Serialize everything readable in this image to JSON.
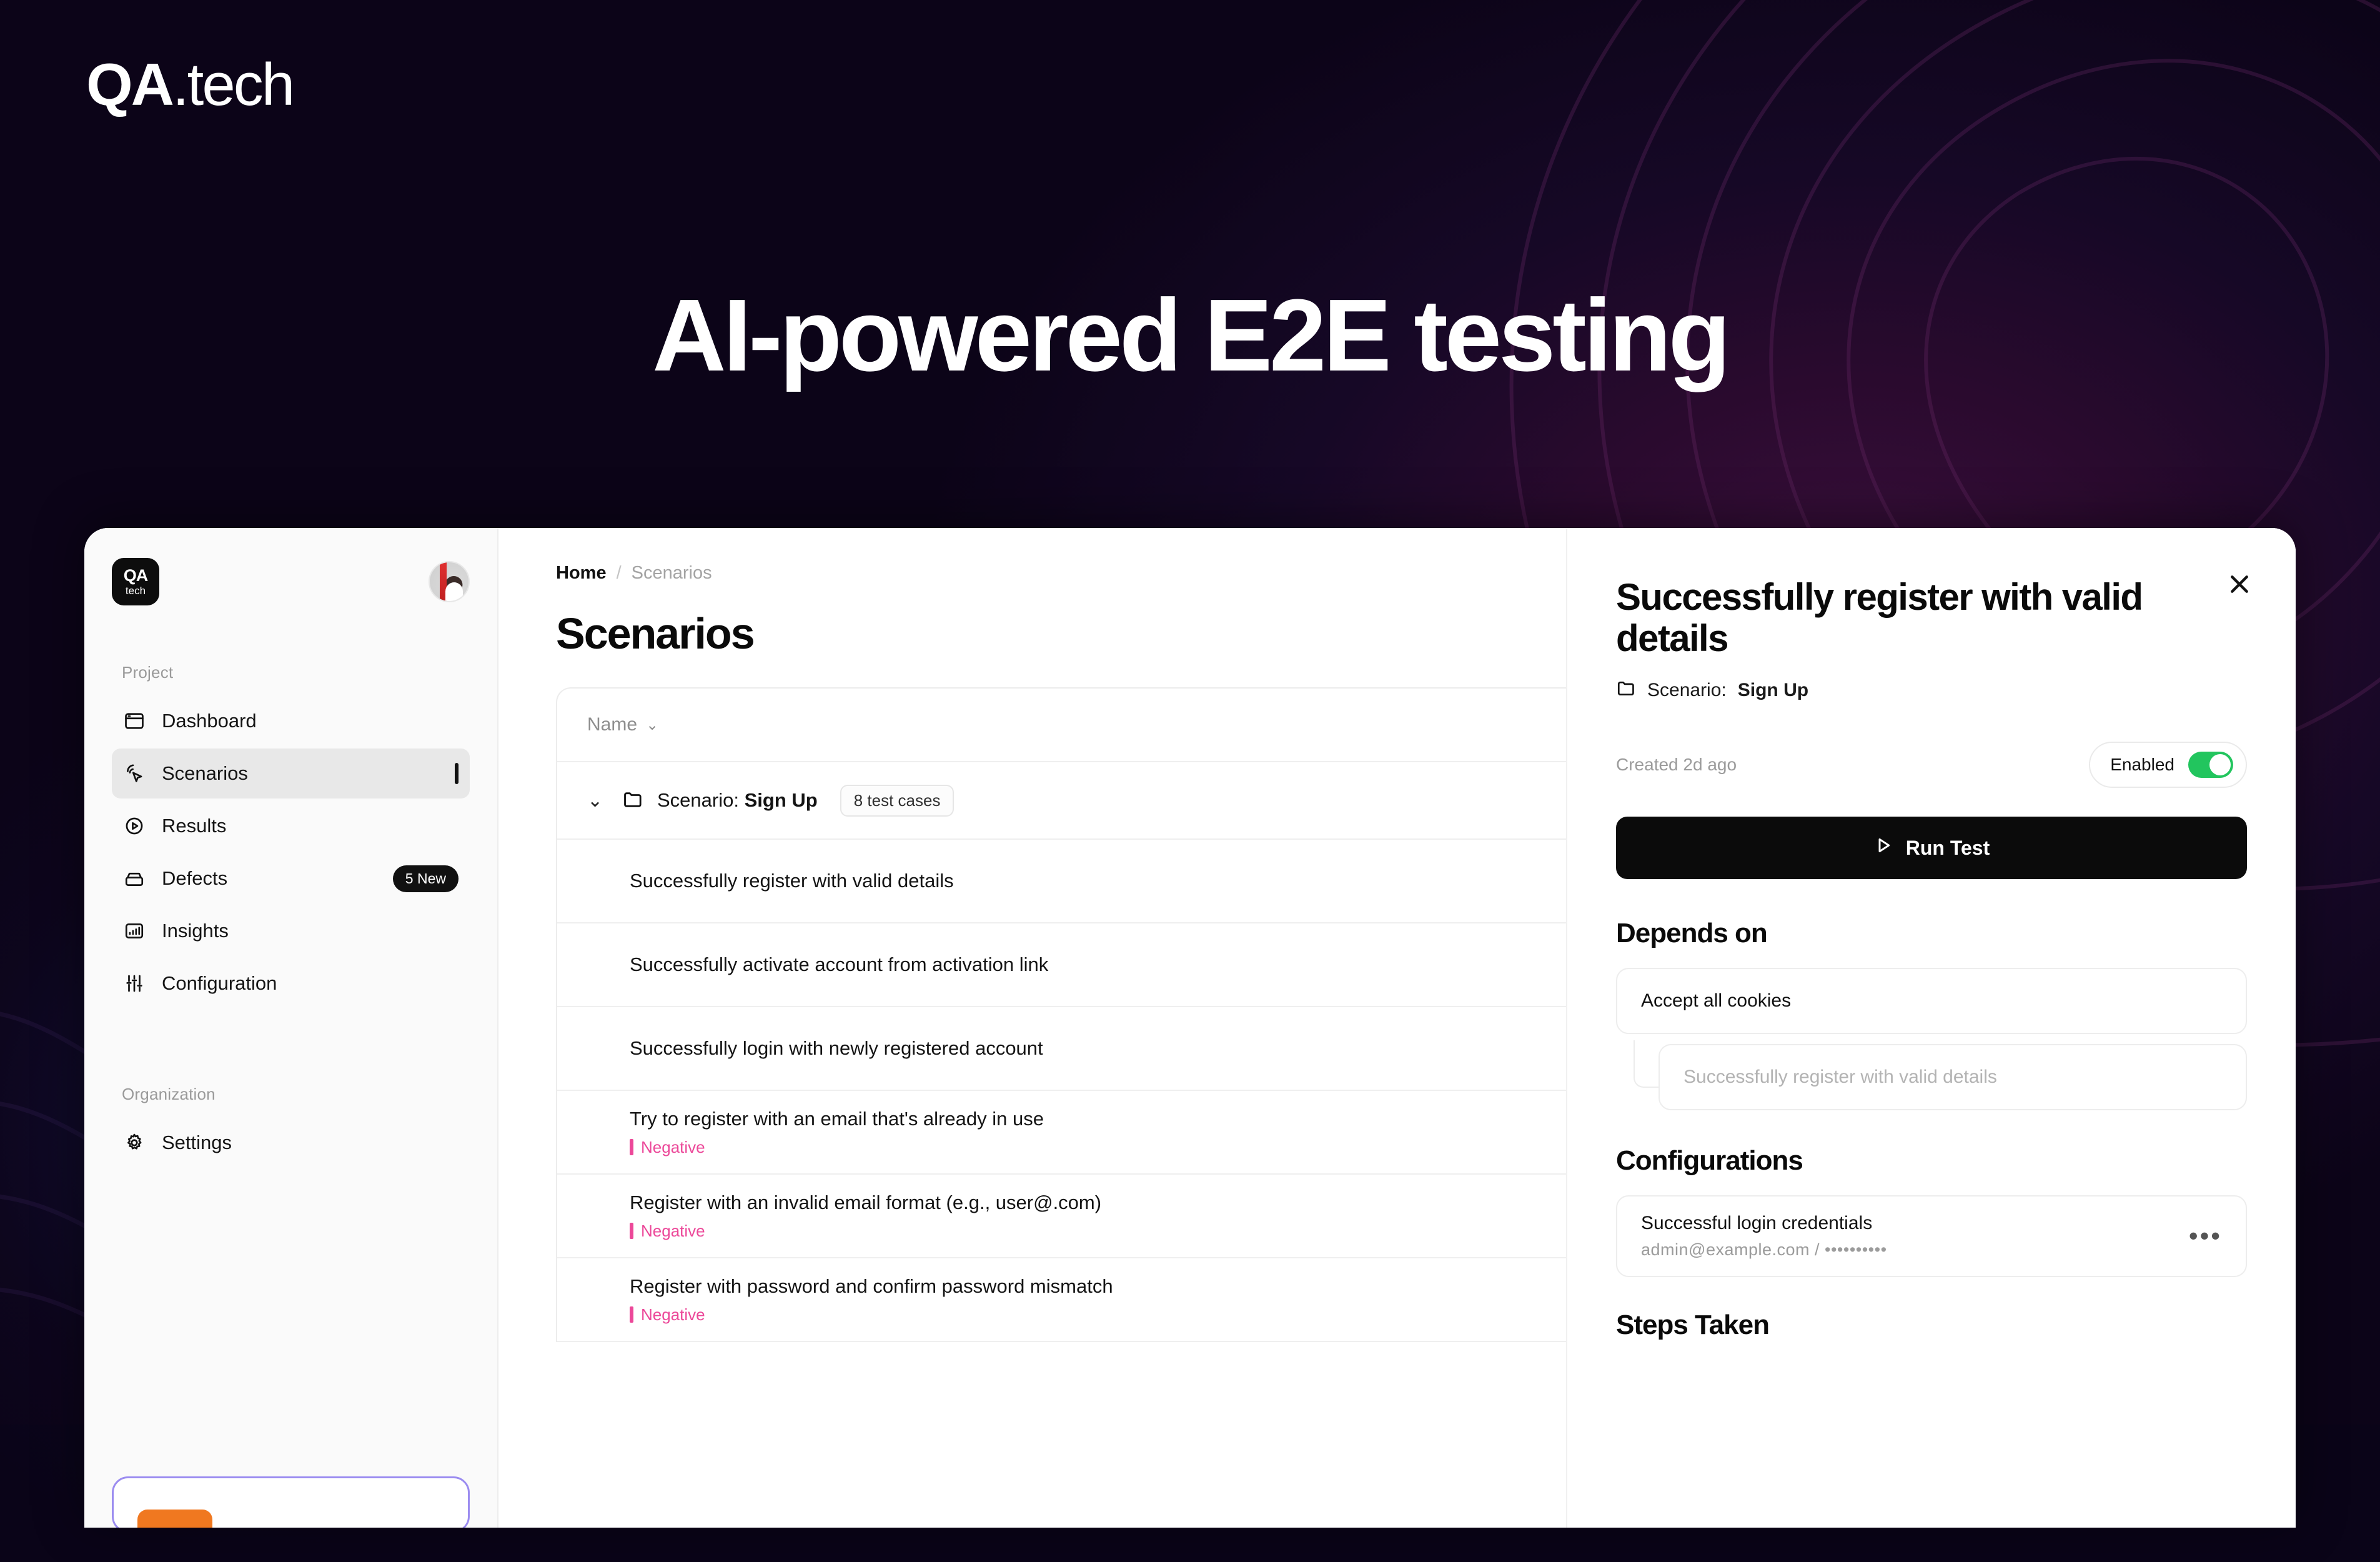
{
  "hero": {
    "logo_main": "QA",
    "logo_suffix": ".tech",
    "headline": "AI-powered E2E testing"
  },
  "sidebar": {
    "logo_tile_top": "QA",
    "logo_tile_bottom": "tech",
    "sections": [
      {
        "label": "Project",
        "items": [
          {
            "label": "Dashboard",
            "icon": "browser-window-icon",
            "active": false,
            "badge": ""
          },
          {
            "label": "Scenarios",
            "icon": "cursor-click-icon",
            "active": true,
            "badge": ""
          },
          {
            "label": "Results",
            "icon": "play-circle-icon",
            "active": false,
            "badge": ""
          },
          {
            "label": "Defects",
            "icon": "bug-box-icon",
            "active": false,
            "badge": "5 New"
          },
          {
            "label": "Insights",
            "icon": "bar-chart-icon",
            "active": false,
            "badge": ""
          },
          {
            "label": "Configuration",
            "icon": "sliders-icon",
            "active": false,
            "badge": ""
          }
        ]
      },
      {
        "label": "Organization",
        "items": [
          {
            "label": "Settings",
            "icon": "gear-icon",
            "active": false,
            "badge": ""
          }
        ]
      }
    ]
  },
  "main": {
    "breadcrumb": {
      "home": "Home",
      "separator": "/",
      "current": "Scenarios"
    },
    "page_title": "Scenarios",
    "table": {
      "sort_column": "Name",
      "scenario_group": {
        "prefix": "Scenario:",
        "name": "Sign Up",
        "chip": "8 test cases"
      },
      "test_cases": [
        {
          "name": "Successfully register with valid details",
          "tag": ""
        },
        {
          "name": "Successfully activate account from activation link",
          "tag": ""
        },
        {
          "name": "Successfully login with newly registered account",
          "tag": ""
        },
        {
          "name": "Try to register with an email that's already in use",
          "tag": "Negative"
        },
        {
          "name": "Register with an invalid email format (e.g., user@.com)",
          "tag": "Negative"
        },
        {
          "name": "Register with password and confirm password mismatch",
          "tag": "Negative"
        }
      ]
    }
  },
  "detail_panel": {
    "title": "Successfully register with valid details",
    "scenario_prefix": "Scenario:",
    "scenario_name": "Sign Up",
    "created": "Created 2d ago",
    "toggle_label": "Enabled",
    "toggle_on": true,
    "run_button": "Run Test",
    "depends_on": {
      "heading": "Depends on",
      "items": [
        {
          "label": "Accept all cookies",
          "muted": false
        },
        {
          "label": "Successfully register with valid details",
          "muted": true
        }
      ]
    },
    "configurations": {
      "heading": "Configurations",
      "items": [
        {
          "name": "Successful login credentials",
          "credentials": "admin@example.com / ••••••••••"
        }
      ]
    },
    "steps_heading": "Steps Taken"
  },
  "colors": {
    "accent_green": "#22c55e",
    "negative_pink": "#ec4899",
    "dark": "#0b0b0b",
    "promo_border": "#9b8cf0",
    "promo_orange": "#f07820"
  }
}
